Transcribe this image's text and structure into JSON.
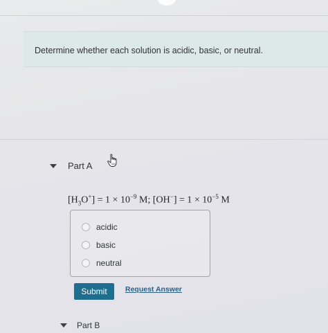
{
  "instructions": {
    "text": "Determine whether each solution is acidic, basic, or neutral."
  },
  "part_a": {
    "label": "Part A",
    "question": {
      "h3o_base": "[H",
      "h3o_sub": "3",
      "h3o_mid": "O",
      "h3o_sup": "+",
      "h3o_eq": "] = 1 × 10",
      "h3o_exp": "−9",
      "h3o_unit": " M; [OH",
      "oh_sup": "−",
      "oh_eq": "] = 1 × 10",
      "oh_exp": "−5",
      "oh_unit": " M"
    },
    "options": [
      {
        "label": "acidic",
        "selected": false
      },
      {
        "label": "basic",
        "selected": false
      },
      {
        "label": "neutral",
        "selected": false
      }
    ],
    "submit_label": "Submit",
    "request_answer_label": "Request Answer"
  },
  "part_b": {
    "label": "Part B"
  },
  "colors": {
    "submit": "#1f6e8f",
    "link": "#2a5f86",
    "instructions_bg": "#dde8e8"
  },
  "icons": {
    "collapse": "triangle-down-icon",
    "cursor": "hand-pointer-icon"
  }
}
